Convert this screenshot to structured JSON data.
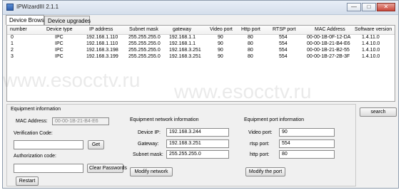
{
  "window": {
    "title": "IPWizardIII 2.1.1"
  },
  "window_controls": {
    "minimize": "—",
    "maximize": "□",
    "close": "✕"
  },
  "tabs": [
    {
      "label": "Device Browse"
    },
    {
      "label": "Device upgrades"
    }
  ],
  "table": {
    "headers": [
      "number",
      "Device type",
      "IP address",
      "Subnet mask",
      "gateway",
      "Video port",
      "Http port",
      "RTSP port",
      "MAC Address",
      "Software version"
    ],
    "rows": [
      [
        "0",
        "IPC",
        "192.168.1.110",
        "255.255.255.0",
        "192.168.1.1",
        "90",
        "80",
        "554",
        "00-00-1B-0F-12-DA",
        "1.4.11.0"
      ],
      [
        "1",
        "IPC",
        "192.168.1.110",
        "255.255.255.0",
        "192.168.1.1",
        "90",
        "80",
        "554",
        "00-00-1B-21-B4-E6",
        "1.4.10.0"
      ],
      [
        "2",
        "IPC",
        "192.168.3.198",
        "255.255.255.0",
        "192.168.3.251",
        "90",
        "80",
        "554",
        "00-00-1B-21-B2-55",
        "1.4.10.0"
      ],
      [
        "3",
        "IPC",
        "192.168.3.199",
        "255.255.255.0",
        "192.168.3.251",
        "90",
        "80",
        "554",
        "00-00-1B-27-2B-3F",
        "1.4.10.0"
      ]
    ]
  },
  "watermark": "www.esocctv.ru",
  "search_button": "search",
  "equipment_info": {
    "title": "Equipment information",
    "mac_label": "MAC Address:",
    "mac_value": "00-00-1B-21-B4-E6",
    "verification_label": "Verification Code:",
    "verification_value": "",
    "get_button": "Get",
    "authorization_label": "Authorization code:",
    "authorization_value": "",
    "clear_button": "Clear Passwords",
    "restart_button": "Restart"
  },
  "network_info": {
    "title": "Equipment network information",
    "ip_label": "Device IP:",
    "ip_value": "192.168.3.244",
    "gateway_label": "Gateway:",
    "gateway_value": "192.168.3.251",
    "subnet_label": "Subnet mask:",
    "subnet_value": "255.255.255.0",
    "modify_button": "Modify network"
  },
  "port_info": {
    "title": "Equipment port information",
    "video_label": "Video port:",
    "video_value": "90",
    "rtsp_label": "rtsp port:",
    "rtsp_value": "554",
    "http_label": "http port:",
    "http_value": "80",
    "modify_button": "Modify the port"
  }
}
